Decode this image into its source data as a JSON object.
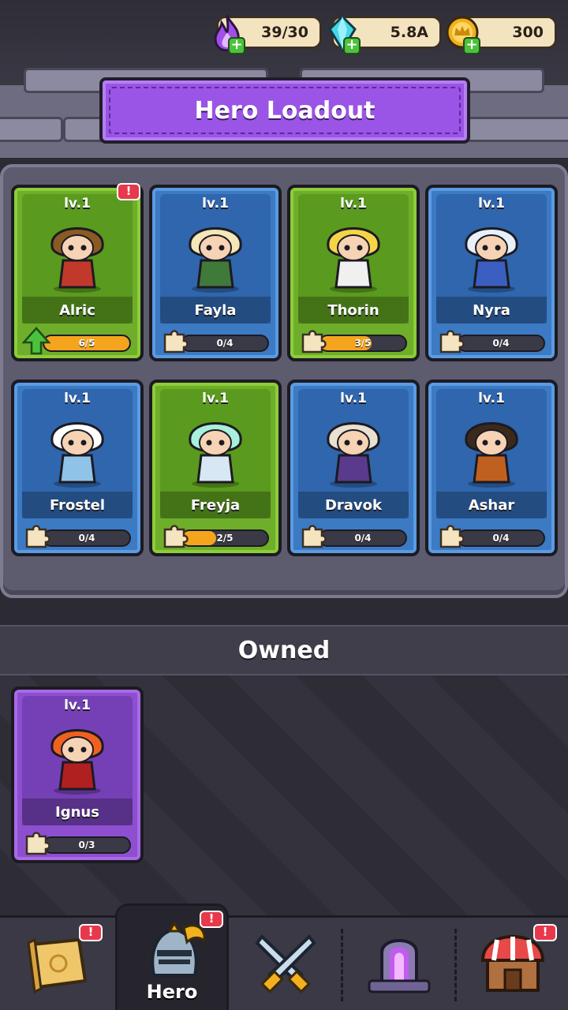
{
  "currencies": [
    {
      "name": "energy",
      "value": "39/30",
      "icon": "purple-flame-icon",
      "color": "#a24fe8"
    },
    {
      "name": "gems",
      "value": "5.8A",
      "icon": "diamond-icon",
      "color": "#48d6e8"
    },
    {
      "name": "coins",
      "value": "300",
      "icon": "crown-coin-icon",
      "color": "#f2b01e"
    }
  ],
  "banner": {
    "title": "Hero Loadout"
  },
  "loadout": {
    "heroes": [
      {
        "name": "Alric",
        "level": "lv.1",
        "progress": "6/5",
        "fill": 1.0,
        "color": "green",
        "icon": "upgrade-arrow-icon",
        "alert": "!"
      },
      {
        "name": "Fayla",
        "level": "lv.1",
        "progress": "0/4",
        "fill": 0.0,
        "color": "blue",
        "icon": "puzzle-piece-icon"
      },
      {
        "name": "Thorin",
        "level": "lv.1",
        "progress": "3/5",
        "fill": 0.6,
        "color": "green",
        "icon": "puzzle-piece-icon"
      },
      {
        "name": "Nyra",
        "level": "lv.1",
        "progress": "0/4",
        "fill": 0.0,
        "color": "blue",
        "icon": "puzzle-piece-icon"
      },
      {
        "name": "Frostel",
        "level": "lv.1",
        "progress": "0/4",
        "fill": 0.0,
        "color": "blue",
        "icon": "puzzle-piece-icon"
      },
      {
        "name": "Freyja",
        "level": "lv.1",
        "progress": "2/5",
        "fill": 0.4,
        "color": "green",
        "icon": "puzzle-piece-icon"
      },
      {
        "name": "Dravok",
        "level": "lv.1",
        "progress": "0/4",
        "fill": 0.0,
        "color": "blue",
        "icon": "puzzle-piece-icon"
      },
      {
        "name": "Ashar",
        "level": "lv.1",
        "progress": "0/4",
        "fill": 0.0,
        "color": "blue",
        "icon": "puzzle-piece-icon"
      }
    ]
  },
  "owned": {
    "title": "Owned",
    "heroes": [
      {
        "name": "Ignus",
        "level": "lv.1",
        "progress": "0/3",
        "fill": 0.0,
        "color": "purple",
        "icon": "puzzle-piece-icon"
      }
    ]
  },
  "nav": {
    "items": [
      {
        "id": "map",
        "icon": "scroll-map-icon",
        "label": "",
        "alert": "!"
      },
      {
        "id": "hero",
        "icon": "knight-helmet-icon",
        "label": "Hero",
        "alert": "!",
        "active": true
      },
      {
        "id": "battle",
        "icon": "crossed-swords-icon",
        "label": ""
      },
      {
        "id": "portal",
        "icon": "portal-icon",
        "label": ""
      },
      {
        "id": "shop",
        "icon": "shop-icon",
        "label": "",
        "alert": "!"
      }
    ]
  }
}
